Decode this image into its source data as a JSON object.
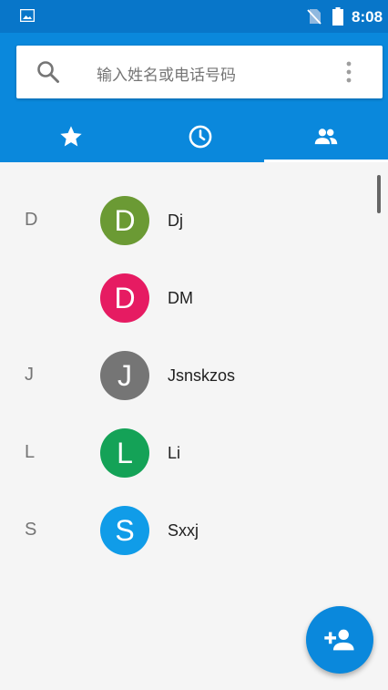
{
  "status_bar": {
    "time": "8:08",
    "left_icon": "image-icon",
    "signal_icon": "no-sim-icon",
    "battery_icon": "battery-icon"
  },
  "search": {
    "placeholder": "输入姓名或电话号码",
    "search_icon": "search-icon",
    "menu_icon": "more-vert-icon"
  },
  "tabs": [
    {
      "icon": "star-icon",
      "selected": false
    },
    {
      "icon": "clock-icon",
      "selected": false
    },
    {
      "icon": "people-icon",
      "selected": true
    }
  ],
  "contacts": [
    {
      "section": "D",
      "initial": "D",
      "name": "Dj",
      "color": "#6b9a34"
    },
    {
      "section": "",
      "initial": "D",
      "name": "DM",
      "color": "#e61b62"
    },
    {
      "section": "J",
      "initial": "J",
      "name": "Jsnskzos",
      "color": "#757575"
    },
    {
      "section": "L",
      "initial": "L",
      "name": "Li",
      "color": "#14a257"
    },
    {
      "section": "S",
      "initial": "S",
      "name": "Sxxj",
      "color": "#109ce8"
    }
  ],
  "fab": {
    "icon": "add-contact-icon"
  },
  "colors": {
    "status_bar": "#0876c9",
    "app_bar": "#0a88dc",
    "background": "#f5f5f5"
  }
}
